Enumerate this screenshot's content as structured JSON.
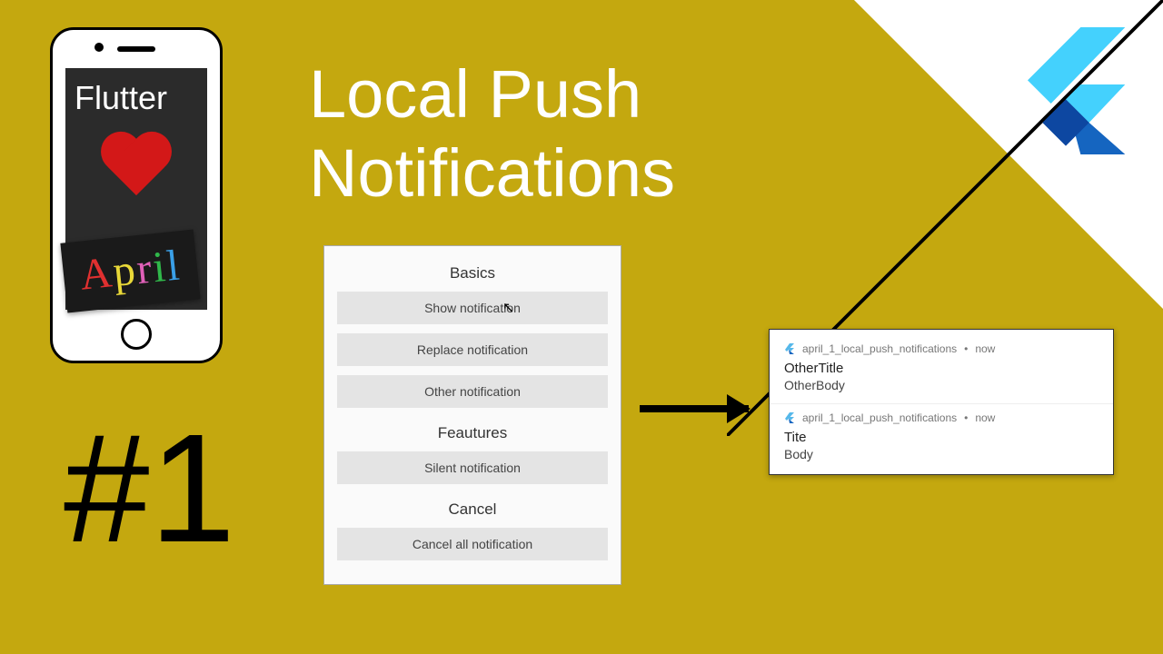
{
  "title_line1": "Local Push",
  "title_line2": "Notifications",
  "episode": "#1",
  "phone": {
    "brand_word": "Flutter",
    "month_tag": "April"
  },
  "app": {
    "sections": [
      {
        "heading": "Basics",
        "buttons": [
          "Show notification",
          "Replace notification",
          "Other notification"
        ]
      },
      {
        "heading": "Feautures",
        "buttons": [
          "Silent notification"
        ]
      },
      {
        "heading": "Cancel",
        "buttons": [
          "Cancel all notification"
        ]
      }
    ]
  },
  "notifications": {
    "app_name": "april_1_local_push_notifications",
    "time": "now",
    "items": [
      {
        "title": "OtherTitle",
        "body": "OtherBody"
      },
      {
        "title": "Tite",
        "body": "Body"
      }
    ]
  }
}
